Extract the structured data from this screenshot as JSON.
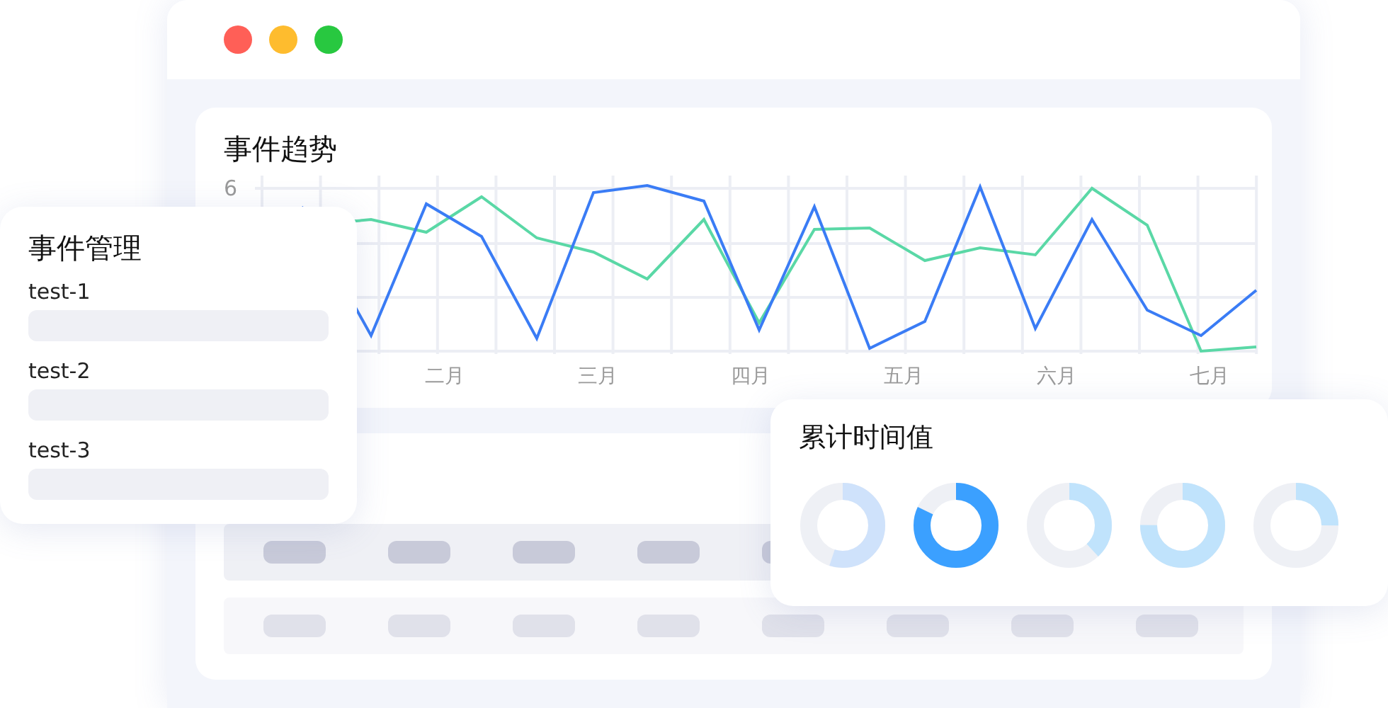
{
  "window": {
    "controls": [
      {
        "color": "#ff5f57"
      },
      {
        "color": "#febc2e"
      },
      {
        "color": "#28c840"
      }
    ]
  },
  "trend_card": {
    "title": "事件趋势",
    "y_tick": "6",
    "x_labels": [
      "二月",
      "三月",
      "四月",
      "五月",
      "六月",
      "七月"
    ]
  },
  "event_card": {
    "title": "事件管理",
    "items": [
      {
        "label": "test-1"
      },
      {
        "label": "test-2"
      },
      {
        "label": "test-3"
      }
    ]
  },
  "cumulative_card": {
    "title": "累计时间值",
    "donuts": [
      {
        "level": 0.55,
        "color": "#cfe2fb"
      },
      {
        "level": 0.82,
        "color": "#3ba0ff"
      },
      {
        "level": 0.38,
        "color": "#c0e3fc"
      },
      {
        "level": 0.75,
        "color": "#c0e3fc"
      },
      {
        "level": 0.25,
        "color": "#c0e3fc"
      }
    ]
  }
}
